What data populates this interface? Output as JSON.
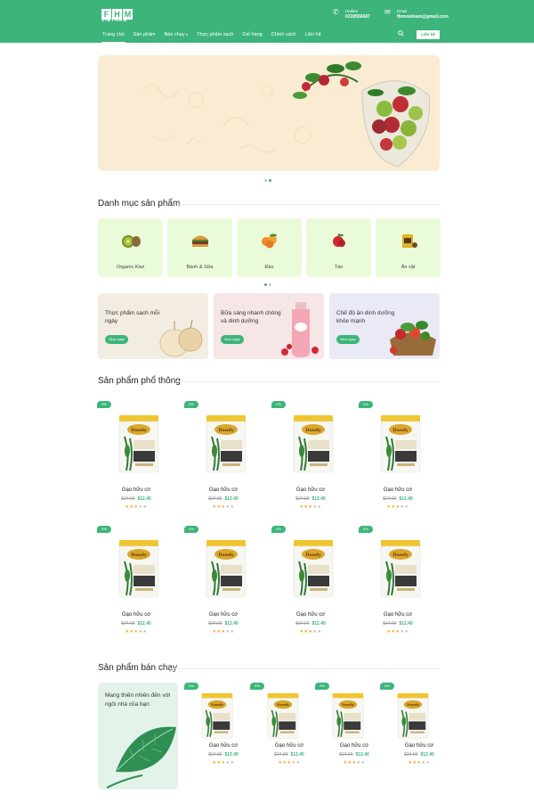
{
  "brand": {
    "logo_letters": [
      "F",
      "H",
      "M"
    ],
    "logo_sub": "VIETNAM"
  },
  "header": {
    "hotline_label": "Hotline",
    "hotline_value": "0339556687",
    "email_label": "Email",
    "email_value": "fhmvietnam@gmail.com",
    "contact_button": "Liên hệ"
  },
  "nav": {
    "items": [
      "Trang chủ",
      "Sản phẩm",
      "Bán chạy",
      "Thực phẩm sạch",
      "Giỏ hàng",
      "Chính sách",
      "Liên hệ"
    ]
  },
  "categories": {
    "title": "Danh mục sản phẩm",
    "items": [
      {
        "label": "Organic Kiwi",
        "icon": "kiwi-icon"
      },
      {
        "label": "Bánh & Sữa",
        "icon": "burger-icon"
      },
      {
        "label": "Đào",
        "icon": "peach-icon"
      },
      {
        "label": "Táo",
        "icon": "apple-icon"
      },
      {
        "label": "Ăn vặt",
        "icon": "snack-icon"
      }
    ]
  },
  "promos": [
    {
      "text": "Thực phẩm sạch mỗi ngày",
      "button": "Mua ngay",
      "bg": "#f3ece2"
    },
    {
      "text": "Bữa sáng nhanh chóng và dinh dưỡng",
      "button": "Mua ngay",
      "bg": "#f6e6e6"
    },
    {
      "text": "Chế độ ăn dinh dưỡng khỏe mạnh",
      "button": "Mua ngay",
      "bg": "#e9eaf6"
    }
  ],
  "popular": {
    "title": "Sản phẩm phổ thông",
    "products": [
      {
        "badge": "0%",
        "name": "Gạo hữu cơ",
        "old_price": "$24.00",
        "price": "$12.40",
        "rating": 3
      },
      {
        "badge": "0%",
        "name": "Gạo hữu cơ",
        "old_price": "$24.00",
        "price": "$12.40",
        "rating": 3
      },
      {
        "badge": "0%",
        "name": "Gạo hữu cơ",
        "old_price": "$24.00",
        "price": "$12.40",
        "rating": 3
      },
      {
        "badge": "0%",
        "name": "Gạo hữu cơ",
        "old_price": "$24.00",
        "price": "$12.40",
        "rating": 3
      },
      {
        "badge": "0%",
        "name": "Gạo hữu cơ",
        "old_price": "$24.00",
        "price": "$12.40",
        "rating": 3
      },
      {
        "badge": "0%",
        "name": "Gạo hữu cơ",
        "old_price": "$24.00",
        "price": "$12.40",
        "rating": 3
      },
      {
        "badge": "0%",
        "name": "Gạo hữu cơ",
        "old_price": "$24.00",
        "price": "$12.40",
        "rating": 3
      },
      {
        "badge": "0%",
        "name": "Gạo hữu cơ",
        "old_price": "$24.00",
        "price": "$12.40",
        "rating": 3
      }
    ]
  },
  "bestsellers": {
    "title": "Sản phẩm bán chạy",
    "side_text": "Mang thiên nhiên đến với ngôi nhà của bạn",
    "products": [
      {
        "badge": "0%",
        "name": "Gạo hữu cơ",
        "old_price": "$24.00",
        "price": "$12.40",
        "rating": 3
      },
      {
        "badge": "0%",
        "name": "Gạo hữu cơ",
        "old_price": "$24.00",
        "price": "$12.40",
        "rating": 3
      },
      {
        "badge": "0%",
        "name": "Gạo hữu cơ",
        "old_price": "$24.00",
        "price": "$12.40",
        "rating": 3
      },
      {
        "badge": "0%",
        "name": "Gạo hữu cơ",
        "old_price": "$24.00",
        "price": "$12.40",
        "rating": 3
      }
    ]
  },
  "colors": {
    "accent": "#3db57a",
    "banner_bg": "#f9ecd2",
    "category_bg": "#eafbd9"
  }
}
